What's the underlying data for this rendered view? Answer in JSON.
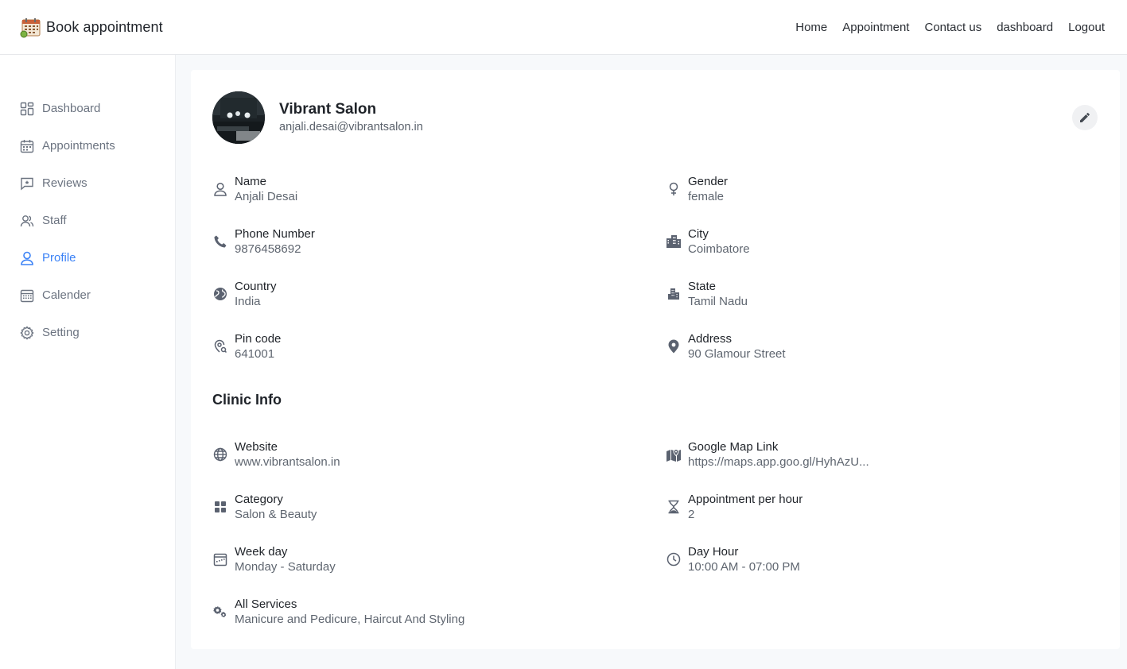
{
  "app": {
    "title": "Book appointment",
    "brand_icon": "calendar-icon"
  },
  "topnav": {
    "items": [
      "Home",
      "Appointment",
      "Contact us",
      "dashboard",
      "Logout"
    ]
  },
  "sidebar": {
    "items": [
      {
        "label": "Dashboard",
        "icon": "dashboard-grid-icon"
      },
      {
        "label": "Appointments",
        "icon": "calendar-icon"
      },
      {
        "label": "Reviews",
        "icon": "review-icon"
      },
      {
        "label": "Staff",
        "icon": "users-icon"
      },
      {
        "label": "Profile",
        "icon": "user-icon",
        "active": true
      },
      {
        "label": "Calender",
        "icon": "calendar-grid-icon"
      },
      {
        "label": "Setting",
        "icon": "gear-icon"
      }
    ],
    "active_color": "#3b82f6"
  },
  "profile": {
    "name": "Vibrant Salon",
    "email": "anjali.desai@vibrantsalon.in"
  },
  "personal": {
    "name": {
      "label": "Name",
      "value": "Anjali Desai"
    },
    "gender": {
      "label": "Gender",
      "value": "female"
    },
    "phone": {
      "label": "Phone Number",
      "value": "9876458692"
    },
    "city": {
      "label": "City",
      "value": "Coimbatore"
    },
    "country": {
      "label": "Country",
      "value": "India"
    },
    "state": {
      "label": "State",
      "value": "Tamil Nadu"
    },
    "pincode": {
      "label": "Pin code",
      "value": "641001"
    },
    "address": {
      "label": "Address",
      "value": "90 Glamour Street"
    }
  },
  "clinic": {
    "title": "Clinic Info",
    "website": {
      "label": "Website",
      "value": "www.vibrantsalon.in"
    },
    "maplink": {
      "label": "Google Map Link",
      "value": "https://maps.app.goo.gl/HyhAzU..."
    },
    "category": {
      "label": "Category",
      "value": "Salon & Beauty"
    },
    "per_hour": {
      "label": "Appointment per hour",
      "value": "2"
    },
    "weekday": {
      "label": "Week day",
      "value": "Monday - Saturday"
    },
    "dayhour": {
      "label": "Day Hour",
      "value": "10:00 AM - 07:00 PM"
    },
    "services": {
      "label": "All Services",
      "value": "Manicure and Pedicure, Haircut And Styling"
    }
  }
}
